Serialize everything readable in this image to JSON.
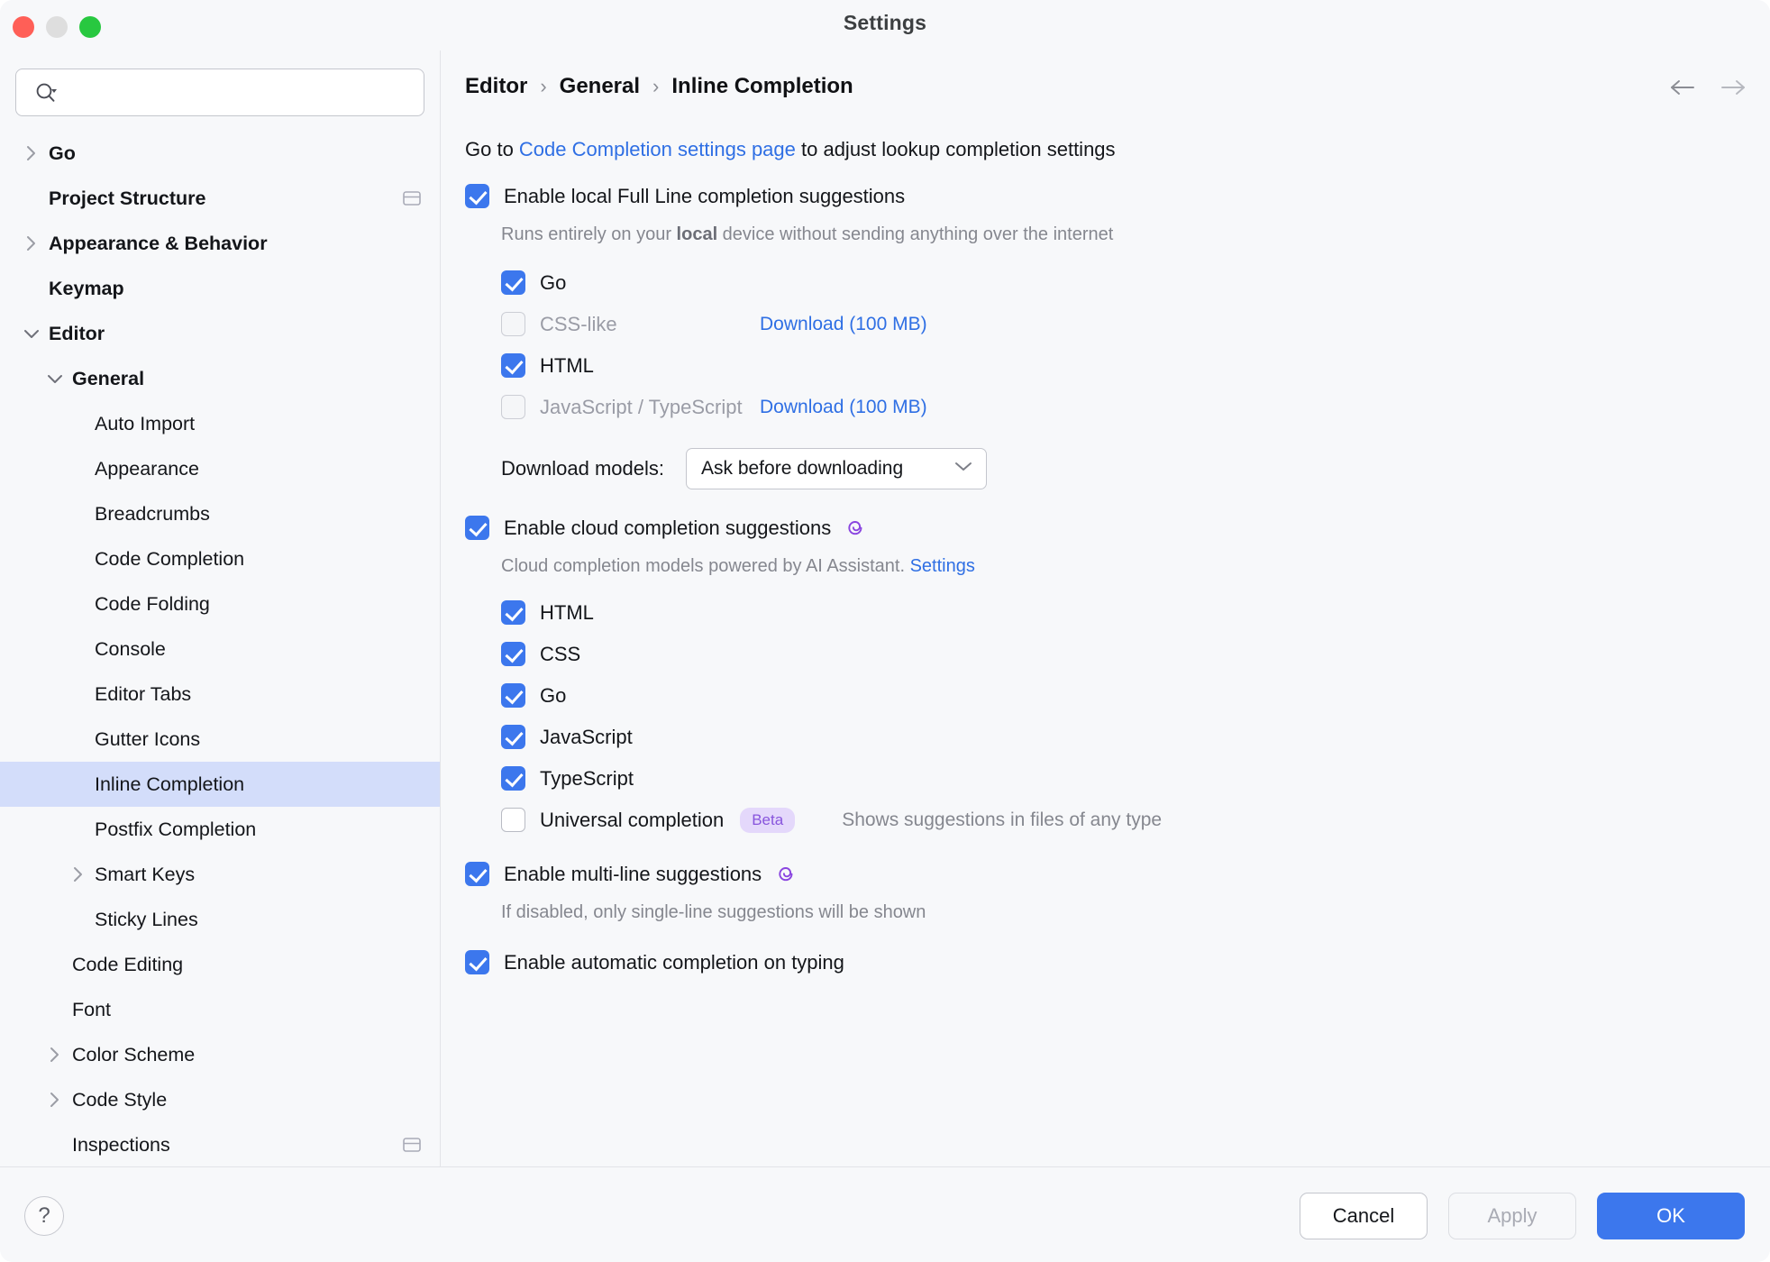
{
  "window": {
    "title": "Settings",
    "traffic_lights": [
      "close-button",
      "minimize-button",
      "maximize-button"
    ]
  },
  "search": {
    "value": "",
    "placeholder": "",
    "icon": "search-icon"
  },
  "sidebar": {
    "items": [
      {
        "label": "Go",
        "depth": 0,
        "bold": true,
        "twisty": "right",
        "badge": false,
        "selected": false
      },
      {
        "label": "Project Structure",
        "depth": 0,
        "bold": true,
        "twisty": "none",
        "badge": true,
        "selected": false
      },
      {
        "label": "Appearance & Behavior",
        "depth": 0,
        "bold": true,
        "twisty": "right",
        "badge": false,
        "selected": false
      },
      {
        "label": "Keymap",
        "depth": 0,
        "bold": true,
        "twisty": "none",
        "badge": false,
        "selected": false
      },
      {
        "label": "Editor",
        "depth": 0,
        "bold": true,
        "twisty": "down",
        "badge": false,
        "selected": false
      },
      {
        "label": "General",
        "depth": 1,
        "bold": true,
        "twisty": "down",
        "badge": false,
        "selected": false
      },
      {
        "label": "Auto Import",
        "depth": 2,
        "bold": false,
        "twisty": "none",
        "badge": false,
        "selected": false
      },
      {
        "label": "Appearance",
        "depth": 2,
        "bold": false,
        "twisty": "none",
        "badge": false,
        "selected": false
      },
      {
        "label": "Breadcrumbs",
        "depth": 2,
        "bold": false,
        "twisty": "none",
        "badge": false,
        "selected": false
      },
      {
        "label": "Code Completion",
        "depth": 2,
        "bold": false,
        "twisty": "none",
        "badge": false,
        "selected": false
      },
      {
        "label": "Code Folding",
        "depth": 2,
        "bold": false,
        "twisty": "none",
        "badge": false,
        "selected": false
      },
      {
        "label": "Console",
        "depth": 2,
        "bold": false,
        "twisty": "none",
        "badge": false,
        "selected": false
      },
      {
        "label": "Editor Tabs",
        "depth": 2,
        "bold": false,
        "twisty": "none",
        "badge": false,
        "selected": false
      },
      {
        "label": "Gutter Icons",
        "depth": 2,
        "bold": false,
        "twisty": "none",
        "badge": false,
        "selected": false
      },
      {
        "label": "Inline Completion",
        "depth": 2,
        "bold": false,
        "twisty": "none",
        "badge": false,
        "selected": true
      },
      {
        "label": "Postfix Completion",
        "depth": 2,
        "bold": false,
        "twisty": "none",
        "badge": false,
        "selected": false
      },
      {
        "label": "Smart Keys",
        "depth": 2,
        "bold": false,
        "twisty": "right",
        "badge": false,
        "selected": false
      },
      {
        "label": "Sticky Lines",
        "depth": 2,
        "bold": false,
        "twisty": "none",
        "badge": false,
        "selected": false
      },
      {
        "label": "Code Editing",
        "depth": 1,
        "bold": false,
        "twisty": "none",
        "badge": false,
        "selected": false
      },
      {
        "label": "Font",
        "depth": 1,
        "bold": false,
        "twisty": "none",
        "badge": false,
        "selected": false
      },
      {
        "label": "Color Scheme",
        "depth": 1,
        "bold": false,
        "twisty": "right",
        "badge": false,
        "selected": false
      },
      {
        "label": "Code Style",
        "depth": 1,
        "bold": false,
        "twisty": "right",
        "badge": false,
        "selected": false
      },
      {
        "label": "Inspections",
        "depth": 1,
        "bold": false,
        "twisty": "none",
        "badge": true,
        "selected": false
      }
    ]
  },
  "breadcrumb": {
    "parts": [
      "Editor",
      "General",
      "Inline Completion"
    ],
    "separator": "›",
    "back_icon": "arrow-left-icon",
    "forward_icon": "arrow-right-icon"
  },
  "main": {
    "lead": {
      "prefix": "Go to ",
      "link": "Code Completion settings page",
      "suffix": " to adjust lookup completion settings"
    },
    "local_section": {
      "checkbox_label": "Enable local Full Line completion suggestions",
      "checked": true,
      "description_pre": "Runs entirely on your ",
      "description_bold": "local",
      "description_post": " device without sending anything over the internet",
      "languages": [
        {
          "label": "Go",
          "checked": true,
          "disabled": false,
          "download": ""
        },
        {
          "label": "CSS-like",
          "checked": false,
          "disabled": true,
          "download": "Download (100 MB)"
        },
        {
          "label": "HTML",
          "checked": true,
          "disabled": false,
          "download": ""
        },
        {
          "label": "JavaScript / TypeScript",
          "checked": false,
          "disabled": true,
          "download": "Download (100 MB)"
        }
      ],
      "download_models_label": "Download models:",
      "download_models_value": "Ask before downloading",
      "download_models_options": [
        "Ask before downloading"
      ]
    },
    "cloud_section": {
      "checkbox_label": "Enable cloud completion suggestions",
      "checked": true,
      "ai_icon": "ai-assistant-icon",
      "description_text": "Cloud completion models powered by AI Assistant. ",
      "description_link": "Settings",
      "languages": [
        {
          "label": "HTML",
          "checked": true
        },
        {
          "label": "CSS",
          "checked": true
        },
        {
          "label": "Go",
          "checked": true
        },
        {
          "label": "JavaScript",
          "checked": true
        },
        {
          "label": "TypeScript",
          "checked": true
        }
      ],
      "universal": {
        "label": "Universal completion",
        "checked": false,
        "badge": "Beta",
        "hint": "Shows suggestions in files of any type"
      }
    },
    "multiline_section": {
      "checkbox_label": "Enable multi-line suggestions",
      "checked": true,
      "ai_icon": "ai-assistant-icon",
      "description": "If disabled, only single-line suggestions will be shown"
    },
    "autotype_section": {
      "checkbox_label": "Enable automatic completion on typing",
      "checked": true
    }
  },
  "footer": {
    "help_label": "?",
    "cancel_label": "Cancel",
    "apply_label": "Apply",
    "apply_disabled": true,
    "ok_label": "OK"
  },
  "colors": {
    "accent": "#3c77ed",
    "link": "#2f6fe4",
    "selection": "#d3ddfa",
    "ai_purple": "#8855dd",
    "badge_bg": "#e4d8fb",
    "window_bg": "#f7f8fa",
    "muted_text": "#85878f"
  }
}
